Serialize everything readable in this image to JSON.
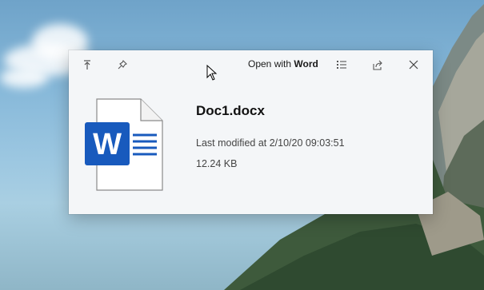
{
  "toolbar": {
    "open_with_prefix": "Open with ",
    "open_with_app": "Word",
    "icons": [
      "move-to-top-icon",
      "pin-icon",
      "properties-icon",
      "share-icon",
      "close-icon"
    ]
  },
  "file": {
    "name": "Doc1.docx",
    "modified": "Last modified at 2/10/20 09:03:51",
    "size": "12.24 KB",
    "icon_letter": "W"
  },
  "colors": {
    "word_blue": "#185abd",
    "panel_bg": "#f4f6f8"
  }
}
